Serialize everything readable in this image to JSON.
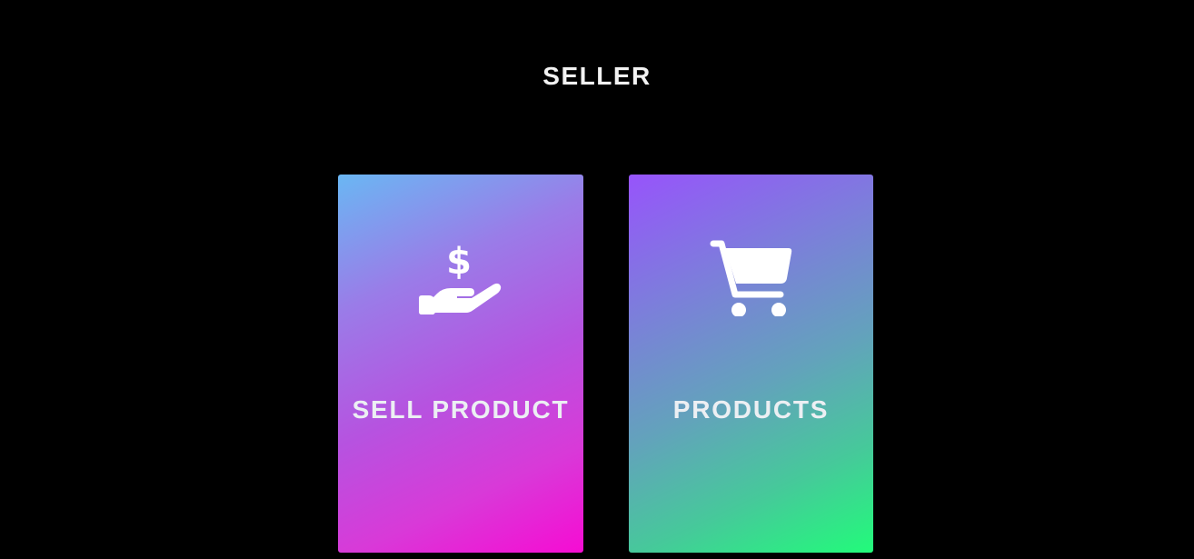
{
  "header": {
    "title": "SELLER"
  },
  "cards": [
    {
      "label": "SELL PRODUCT",
      "icon": "hand-dollar-icon",
      "gradient_start": "#6ab7f3",
      "gradient_end": "#f60cd3"
    },
    {
      "label": "PRODUCTS",
      "icon": "shopping-cart-icon",
      "gradient_start": "#9754fb",
      "gradient_end": "#22fb7a"
    }
  ],
  "colors": {
    "background": "#000000",
    "text": "#eceff3"
  }
}
